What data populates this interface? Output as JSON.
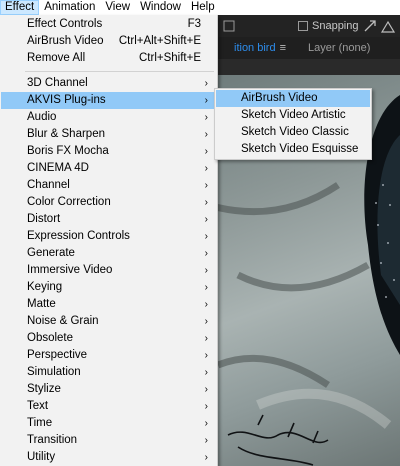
{
  "menubar": {
    "items": [
      {
        "label": "Effect",
        "active": true
      },
      {
        "label": "Animation"
      },
      {
        "label": "View"
      },
      {
        "label": "Window"
      },
      {
        "label": "Help"
      }
    ]
  },
  "toolbar": {
    "snapping_label": "Snapping"
  },
  "panel": {
    "comp_tab": "ition bird",
    "layer_tab": "Layer (none)"
  },
  "effect_menu": {
    "top_items": [
      {
        "label": "Effect Controls",
        "shortcut": "F3"
      },
      {
        "label": "AirBrush Video",
        "shortcut": "Ctrl+Alt+Shift+E"
      },
      {
        "label": "Remove All",
        "shortcut": "Ctrl+Shift+E"
      }
    ],
    "categories": [
      "3D Channel",
      "AKVIS Plug-ins",
      "Audio",
      "Blur & Sharpen",
      "Boris FX Mocha",
      "CINEMA 4D",
      "Channel",
      "Color Correction",
      "Distort",
      "Expression Controls",
      "Generate",
      "Immersive Video",
      "Keying",
      "Matte",
      "Noise & Grain",
      "Obsolete",
      "Perspective",
      "Simulation",
      "Stylize",
      "Text",
      "Time",
      "Transition",
      "Utility"
    ],
    "highlighted_category": "AKVIS Plug-ins",
    "submenu_arrow": "›"
  },
  "akvis_submenu": {
    "items": [
      "AirBrush Video",
      "Sketch Video Artistic",
      "Sketch Video Classic",
      "Sketch Video Esquisse"
    ],
    "highlighted": "AirBrush Video"
  },
  "colors": {
    "menu_bg": "#f2f2f2",
    "highlight": "#91c9f7",
    "comp_tab_accent": "#2d8ceb"
  }
}
